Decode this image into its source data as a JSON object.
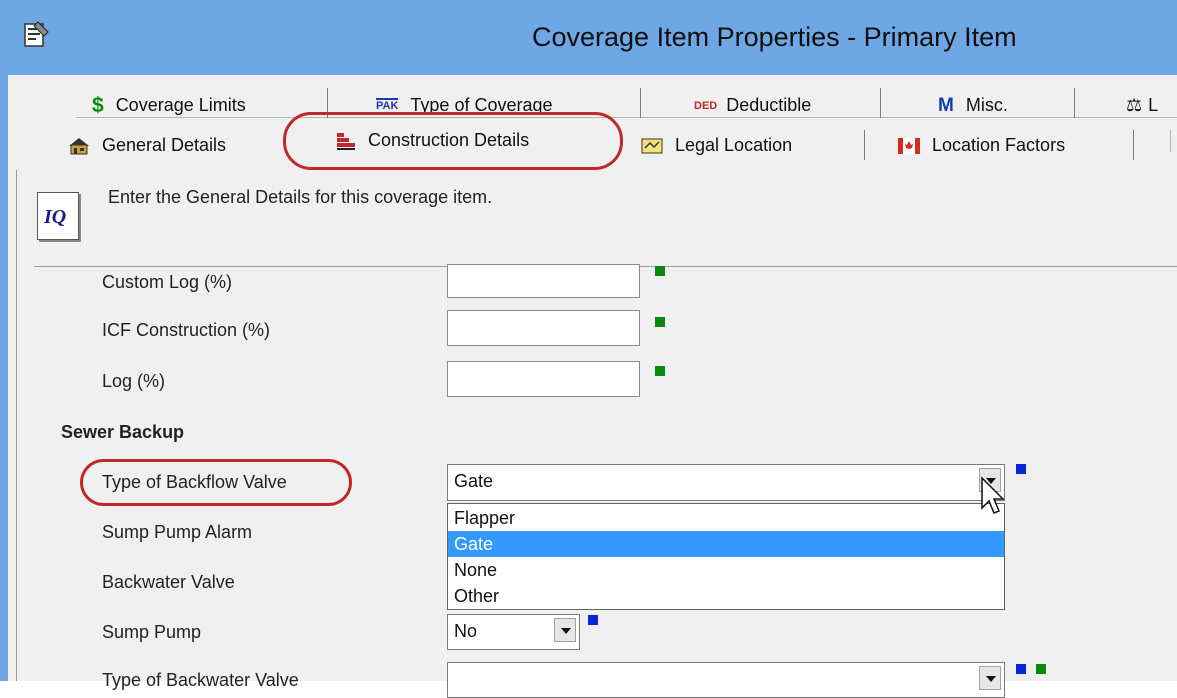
{
  "window": {
    "title": "Coverage Item Properties - Primary Item",
    "icon": "properties-icon"
  },
  "tabs_row1": [
    {
      "label": "Coverage Limits",
      "icon": "dollar-icon",
      "glyph": "$"
    },
    {
      "label": "Type of Coverage",
      "icon": "pak-icon",
      "glyph": "PAK"
    },
    {
      "label": "Deductible",
      "icon": "ded-icon",
      "glyph": "DED"
    },
    {
      "label": "Misc.",
      "icon": "misc-m-icon",
      "glyph": "M"
    },
    {
      "label": "L",
      "icon": "scales-icon",
      "glyph": "⚖"
    }
  ],
  "tabs_row2": [
    {
      "label": "General Details",
      "icon": "house-icon"
    },
    {
      "label": "Construction Details",
      "icon": "bricks-icon",
      "active": true
    },
    {
      "label": "Legal Location",
      "icon": "map-icon"
    },
    {
      "label": "Location Factors",
      "icon": "canada-flag-icon"
    }
  ],
  "hint": {
    "text": "Enter the General Details for this coverage item.",
    "icon_glyph": "IQ"
  },
  "fields": [
    {
      "label": "Custom Log (%)",
      "value": ""
    },
    {
      "label": "ICF Construction (%)",
      "value": ""
    },
    {
      "label": "Log (%)",
      "value": ""
    }
  ],
  "section": {
    "title": "Sewer Backup"
  },
  "sewer": {
    "backflow_label": "Type of Backflow Valve",
    "backflow_value": "Gate",
    "backflow_options": [
      "Flapper",
      "Gate",
      "None",
      "Other"
    ],
    "sump_alarm_label": "Sump Pump Alarm",
    "backwater_label": "Backwater Valve",
    "sump_pump_label": "Sump Pump",
    "sump_pump_value": "No",
    "backwater_type_label": "Type of Backwater Valve",
    "backwater_type_value": ""
  },
  "colors": {
    "titlebar": "#6fa6e4",
    "highlight_ring": "#c0282a",
    "selected_option": "#3399ff",
    "required_marker": "#0a8a0a",
    "info_marker": "#0a24d8"
  }
}
